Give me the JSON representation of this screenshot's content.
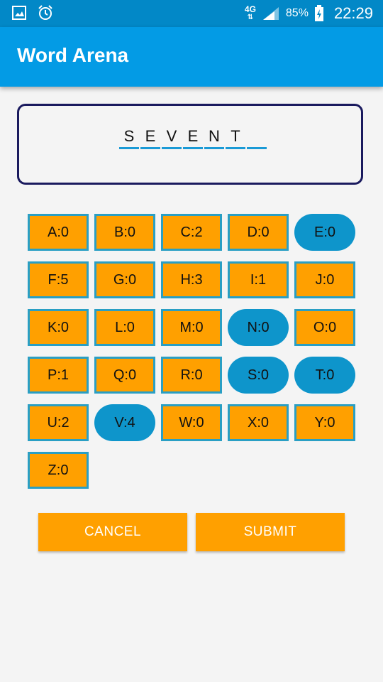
{
  "status_bar": {
    "network": "4G",
    "battery": "85%",
    "time": "22:29"
  },
  "app": {
    "title": "Word Arena"
  },
  "word": {
    "letters": [
      "S",
      "E",
      "V",
      "E",
      "N",
      "T",
      ""
    ]
  },
  "keys": [
    {
      "label": "A:0",
      "selected": false
    },
    {
      "label": "B:0",
      "selected": false
    },
    {
      "label": "C:2",
      "selected": false
    },
    {
      "label": "D:0",
      "selected": false
    },
    {
      "label": "E:0",
      "selected": true
    },
    {
      "label": "F:5",
      "selected": false
    },
    {
      "label": "G:0",
      "selected": false
    },
    {
      "label": "H:3",
      "selected": false
    },
    {
      "label": "I:1",
      "selected": false
    },
    {
      "label": "J:0",
      "selected": false
    },
    {
      "label": "K:0",
      "selected": false
    },
    {
      "label": "L:0",
      "selected": false
    },
    {
      "label": "M:0",
      "selected": false
    },
    {
      "label": "N:0",
      "selected": true
    },
    {
      "label": "O:0",
      "selected": false
    },
    {
      "label": "P:1",
      "selected": false
    },
    {
      "label": "Q:0",
      "selected": false
    },
    {
      "label": "R:0",
      "selected": false
    },
    {
      "label": "S:0",
      "selected": true
    },
    {
      "label": "T:0",
      "selected": true
    },
    {
      "label": "U:2",
      "selected": false
    },
    {
      "label": "V:4",
      "selected": true
    },
    {
      "label": "W:0",
      "selected": false
    },
    {
      "label": "X:0",
      "selected": false
    },
    {
      "label": "Y:0",
      "selected": false
    },
    {
      "label": "Z:0",
      "selected": false
    }
  ],
  "buttons": {
    "cancel": "CANCEL",
    "submit": "SUBMIT"
  },
  "colors": {
    "accent": "#ffa000",
    "primary": "#039be5",
    "selected": "#0e95cb",
    "status_bar": "#0288c7"
  }
}
